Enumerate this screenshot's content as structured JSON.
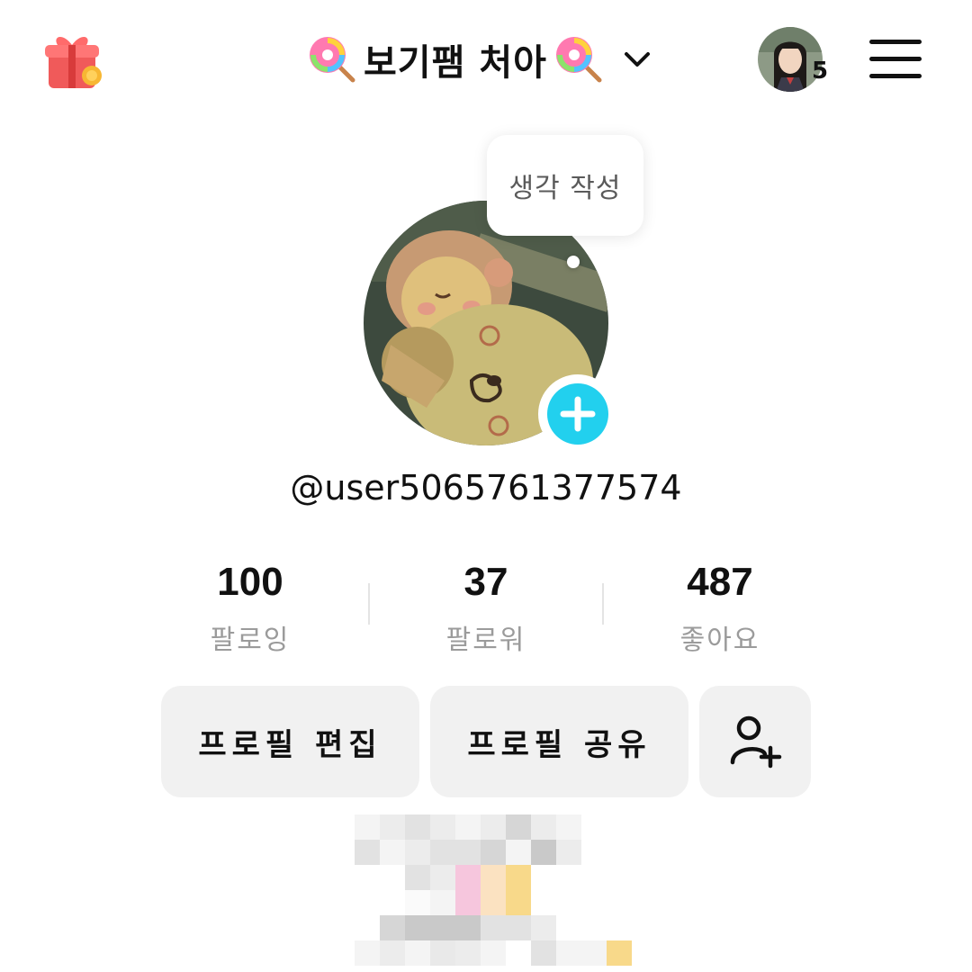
{
  "header": {
    "title": "보기팸 처아",
    "notification_count": "5"
  },
  "profile": {
    "bubble_text": "생각 작성",
    "username": "@user5065761377574"
  },
  "stats": [
    {
      "value": "100",
      "label": "팔로잉"
    },
    {
      "value": "37",
      "label": "팔로워"
    },
    {
      "value": "487",
      "label": "좋아요"
    }
  ],
  "actions": {
    "edit_profile": "프로필 편집",
    "share_profile": "프로필 공유"
  },
  "colors": {
    "accent_plus": "#22d0ee",
    "button_bg": "#f1f1f1",
    "label_gray": "#9b9b9b"
  },
  "icons": [
    "gift-icon",
    "lollipop-icon",
    "chevron-down-icon",
    "menu-icon",
    "plus-icon",
    "add-friend-icon"
  ]
}
